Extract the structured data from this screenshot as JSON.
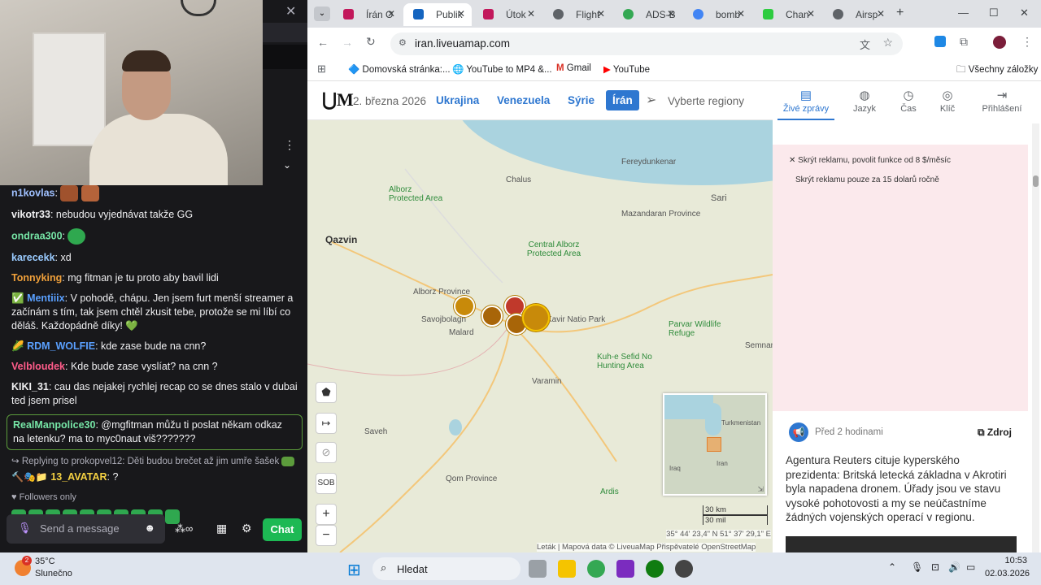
{
  "stream": {
    "chat_messages": [
      {
        "user": "n1kovlas",
        "color": "#b9a3e3",
        "text": "",
        "emotes": 2
      },
      {
        "user": "vikotr33",
        "color": "#ffffff",
        "text": "nebudou vyjednávat takže GG"
      },
      {
        "user": "ondraa300",
        "color": "#76e5a6",
        "text": "",
        "emotes": 1
      },
      {
        "user": "karecekk",
        "color": "#9acbff",
        "text": "xd"
      },
      {
        "user": "Tonnyking",
        "color": "#f0a03a",
        "text": "mg fitman je tu proto aby bavil lidi"
      },
      {
        "user": "Mentiiix",
        "color": "#5aa0ff",
        "text": "V pohodě, chápu. Jen jsem furt menší streamer a začínám s tím, tak jsem chtěl zkusit tebe, protože se mi líbí co děláš. Každopádně díky! 💚"
      },
      {
        "user": "RDM_WOLFIE",
        "color": "#5aa0ff",
        "text": "kde zase bude na cnn?"
      },
      {
        "user": "Velbloudek",
        "color": "#ff5c8a",
        "text": "Kde bude zase vyslíat? na cnn ?"
      },
      {
        "user": "KIKI_31",
        "color": "#ffffff",
        "text": "cau das nejakej rychlej recap co se dnes stalo v dubai ted jsem prisel"
      }
    ],
    "highlight": {
      "user": "RealManpolice30",
      "text": "@mgfitman můžu ti poslat někam odkaz na letenku? ma to myc0naut viš???????"
    },
    "reply_line": "Replying to prokopvel12: Děti budou brečet až jim umře šašek",
    "avatar_msg": {
      "user": "13_AVATAR",
      "text": "?"
    },
    "followers_only": "Followers only",
    "input_placeholder": "Send a message",
    "chat_button": "Chat"
  },
  "browser": {
    "tabs": [
      {
        "label": "Írán O",
        "color": "#c2185b"
      },
      {
        "label": "Publik",
        "color": "#1565c0"
      },
      {
        "label": "Útok",
        "color": "#c2185b"
      },
      {
        "label": "Flight",
        "color": "#5f6368"
      },
      {
        "label": "ADS-B",
        "color": "#34a853"
      },
      {
        "label": "bomb",
        "color": "#4285f4"
      },
      {
        "label": "Chan",
        "color": "#2ecc40"
      },
      {
        "label": "Airsp",
        "color": "#5f6368"
      }
    ],
    "url": "iran.liveuamap.com",
    "bookmarks": [
      "Domovská stránka:...",
      "YouTube to MP4 &...",
      "Gmail",
      "YouTube"
    ],
    "all_bookmarks": "Všechny záložky"
  },
  "site": {
    "date": "2. března 2026",
    "nav": [
      "Ukrajina",
      "Venezuela",
      "Sýrie",
      "Írán"
    ],
    "region_select": "Vyberte regiony",
    "side_tabs": [
      "Živé zprávy",
      "Jazyk",
      "Čas",
      "Klíč",
      "Přihlášení"
    ],
    "ad_line1": "Skrýt reklamu, povolit funkce od 8 $/měsíc",
    "ad_line2": "Skrýt reklamu pouze za 15 dolarů ročně",
    "news_time": "Před 2 hodinami",
    "news_source": "Zdroj",
    "news_text": "Agentura Reuters cituje kyperského prezidenta: Britská letecká základna v Akrotiri byla napadena dronem. Úřady jsou ve stavu vysoké pohotovosti a my se neúčastníme žádných vojenských operací v regionu."
  },
  "map": {
    "labels": [
      "Qazvin",
      "Chalus",
      "Sari",
      "Central Alborz Protected Area",
      "Alborz Province",
      "Savojbolagh",
      "Malard",
      "Varamin",
      "Saveh",
      "Qom Province",
      "Kavir National Park",
      "Semnan",
      "Fereydunkenar",
      "Mazandaran Province",
      "Kuh-e Sefid No Hunting Area",
      "Parvar Wildlife Refuge",
      "Alborz Protected Area",
      "Kavir Natio Park",
      "Ardis"
    ],
    "mini_labels": [
      "Turkmenistan",
      "Iraq",
      "Iran"
    ],
    "scale": [
      "30 km",
      "30 mil"
    ],
    "coords": "35° 44' 23,4\" N 51° 37' 29,1\" E",
    "attribution": "Leták | Mapová data © LiveuaMap Přispěvatelé OpenStreetMap",
    "sob": "SOB"
  },
  "taskbar": {
    "weather_temp": "35°C",
    "weather_desc": "Slunečno",
    "search": "Hledat",
    "time": "10:53",
    "date": "02.03.2026",
    "badge": "2"
  }
}
